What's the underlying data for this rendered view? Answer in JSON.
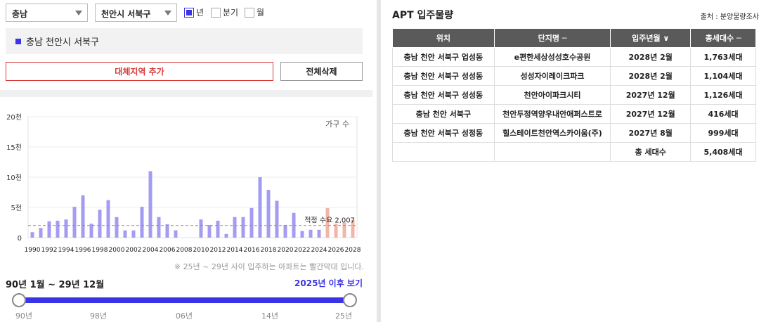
{
  "filters": {
    "province": "충남",
    "district": "천안시 서북구",
    "period_options": [
      {
        "label": "년",
        "checked": true
      },
      {
        "label": "분기",
        "checked": false
      },
      {
        "label": "월",
        "checked": false
      }
    ]
  },
  "region_label": "충남 천안시 서북구",
  "buttons": {
    "add_region": "대체지역 추가",
    "delete_all": "전체삭제"
  },
  "chart_data": {
    "type": "bar",
    "legend": "가구 수",
    "y_ticks": [
      "0",
      "5천",
      "10천",
      "15천",
      "20천"
    ],
    "ylim": [
      0,
      20000
    ],
    "x_tick_labels": [
      "1990",
      "1992",
      "1994",
      "1996",
      "1998",
      "2000",
      "2002",
      "2004",
      "2006",
      "2008",
      "2010",
      "2012",
      "2014",
      "2016",
      "2018",
      "2020",
      "2022",
      "2024",
      "2026",
      "2028"
    ],
    "categories": [
      "1990",
      "1991",
      "1992",
      "1993",
      "1994",
      "1995",
      "1996",
      "1997",
      "1998",
      "1999",
      "2000",
      "2001",
      "2002",
      "2003",
      "2004",
      "2005",
      "2006",
      "2007",
      "2008",
      "2009",
      "2010",
      "2011",
      "2012",
      "2013",
      "2014",
      "2015",
      "2016",
      "2017",
      "2018",
      "2019",
      "2020",
      "2021",
      "2022",
      "2023",
      "2024",
      "2025",
      "2026",
      "2027",
      "2028"
    ],
    "values": [
      900,
      1600,
      2700,
      2800,
      3000,
      5100,
      7000,
      2300,
      4600,
      6200,
      3400,
      1200,
      1200,
      5100,
      11000,
      3400,
      2200,
      1200,
      0,
      0,
      3000,
      2100,
      2800,
      600,
      3400,
      3400,
      4900,
      10000,
      7900,
      6100,
      2100,
      4100,
      1100,
      1300,
      1300,
      4900,
      2300,
      2500,
      2900
    ],
    "highlight_from": "2025",
    "colors": {
      "past": "#a39cf2",
      "future": "#f0b6a8",
      "demand_line": "#e66a6a"
    },
    "demand_line": {
      "label": "적정 수요 2,007",
      "value": 2007
    }
  },
  "note": "※ 25년 ~ 29년 사이 입주하는 아파트는 빨간막대 입니다.",
  "range": {
    "label": "90년 1월 ~ 29년 12월",
    "link": "2025년 이후 보기",
    "ticks": [
      "90년",
      "98년",
      "06년",
      "14년",
      "25년"
    ]
  },
  "table": {
    "title": "APT 입주물량",
    "source": "출처 : 분양물량조사",
    "headers": [
      "위치",
      "단지명 ─",
      "입주년월 ∨",
      "총세대수 ─"
    ],
    "rows": [
      [
        "충남 천안 서북구 업성동",
        "e편한세상성성호수공원",
        "2028년 2월",
        "1,763세대"
      ],
      [
        "충남 천안 서북구 성성동",
        "성성자이레이크파크",
        "2028년 2월",
        "1,104세대"
      ],
      [
        "충남 천안 서북구 성성동",
        "천안아이파크시티",
        "2027년 12월",
        "1,126세대"
      ],
      [
        "충남 천안 서북구",
        "천안두정역양우내안애퍼스트로",
        "2027년 12월",
        "416세대"
      ],
      [
        "충남 천안 서북구 성정동",
        "힐스테이트천안역스카이움(주)",
        "2027년 8월",
        "999세대"
      ]
    ],
    "total_label": "총 세대수",
    "total_value": "5,408세대"
  }
}
